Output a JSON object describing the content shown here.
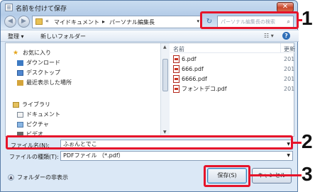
{
  "window": {
    "title": "名前を付けて保存",
    "close_glyph": "✕"
  },
  "nav": {
    "back_glyph": "◀",
    "forward_glyph": "▶",
    "address": {
      "chevron": "«",
      "crumbs": [
        "マイドキュメント",
        "パーソナル編集長"
      ],
      "separator": "▸",
      "dropdown": "▾"
    },
    "refresh_glyph": "↻",
    "search_placeholder": "パーソナル編集長の検索",
    "search_icon": "search-icon"
  },
  "toolbar": {
    "organize": "整理 ▾",
    "new_folder": "新しいフォルダー",
    "view_glyph": "☷ ▾",
    "help_glyph": "?"
  },
  "sidebar": {
    "favorites_label": "お気に入り",
    "items": [
      "ダウンロード",
      "デスクトップ",
      "最近表示した場所"
    ],
    "libraries_label": "ライブラリ",
    "lib_items": [
      "ドキュメント",
      "ピクチャ",
      "ビデオ"
    ]
  },
  "files": {
    "header_name": "名前",
    "header_modified": "更新",
    "rows": [
      {
        "name": "6.pdf",
        "date": "201"
      },
      {
        "name": "666.pdf",
        "date": "201"
      },
      {
        "name": "6666.pdf",
        "date": "201"
      },
      {
        "name": "フォントデコ.pdf",
        "date": "201"
      }
    ]
  },
  "form": {
    "filename_label": "ファイル名(N):",
    "filename_value": "ふぉんとでこ",
    "filetype_label": "ファイルの種類(T):",
    "filetype_value": "PDFファイル （*.pdf）"
  },
  "footer": {
    "hide_folders": "フォルダーの非表示",
    "save": "保存(S)",
    "cancel": "キャンセル"
  },
  "callouts": {
    "one": "1",
    "two": "2",
    "three": "3"
  },
  "colors": {
    "callout_red": "#e6142a",
    "close_red": "#c9462a"
  }
}
